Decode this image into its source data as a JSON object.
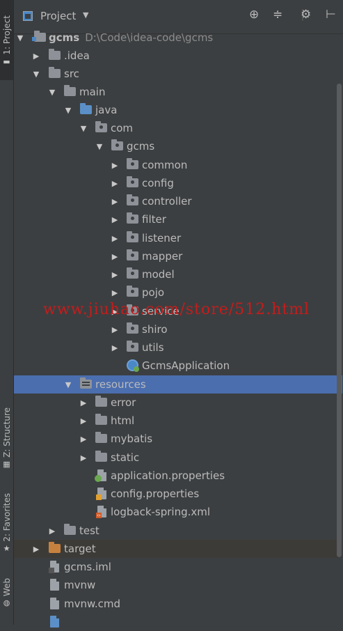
{
  "side_tabs": {
    "project": "1: Project",
    "structure": "Z: Structure",
    "favorites": "2: Favorites",
    "web": "Web"
  },
  "header": {
    "title": "Project",
    "icons": [
      "project-view-icon",
      "dropdown-caret-icon",
      "locate-icon",
      "collapse-all-icon",
      "gear-icon",
      "hide-icon"
    ]
  },
  "tree": {
    "root": {
      "name": "gcms",
      "path": "D:\\Code\\idea-code\\gcms"
    },
    "items": [
      ".idea",
      "src",
      "main",
      "java",
      "com",
      "gcms",
      "common",
      "config",
      "controller",
      "filter",
      "listener",
      "mapper",
      "model",
      "pojo",
      "service",
      "shiro",
      "utils",
      "GcmsApplication",
      "resources",
      "error",
      "html",
      "mybatis",
      "static",
      "application.properties",
      "config.properties",
      "logback-spring.xml",
      "test",
      "target",
      "gcms.iml",
      "mvnw",
      "mvnw.cmd"
    ]
  },
  "watermark": "www.jiuhao.com/store/512.html",
  "colors": {
    "background": "#3c3f41",
    "selection": "#4b6eaf",
    "text": "#bbbbbb"
  }
}
